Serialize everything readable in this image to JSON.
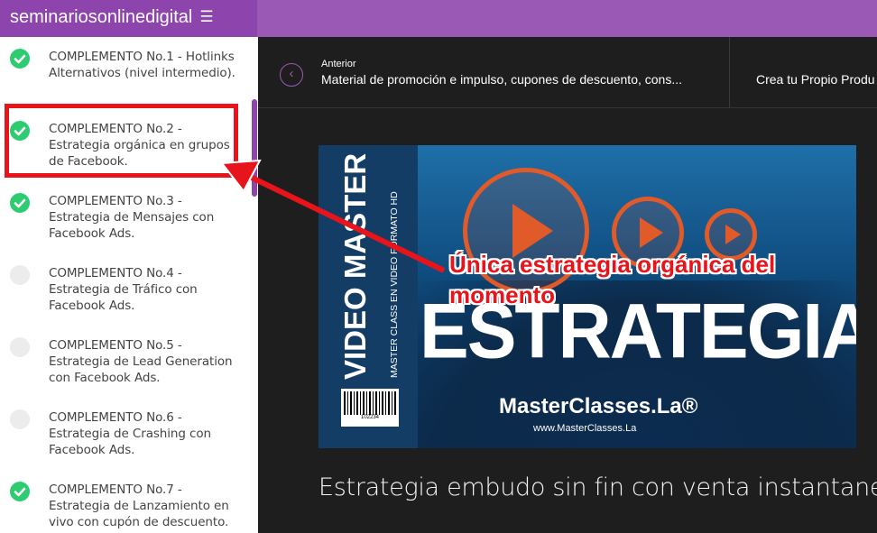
{
  "app": {
    "brand": "seminariosonlinedigital",
    "menu_icon": "hamburger-icon"
  },
  "sidebar": {
    "items": [
      {
        "label": "COMPLEMENTO No.1 - Hotlinks Alternativos (nivel intermedio).",
        "completed": true
      },
      {
        "label": "COMPLEMENTO No.2 - Estrategia orgánica en grupos de Facebook.",
        "completed": true
      },
      {
        "label": "COMPLEMENTO No.3 - Estrategia de Mensajes con Facebook Ads.",
        "completed": true
      },
      {
        "label": "COMPLEMENTO No.4 - Estrategia de Tráfico con Facebook Ads.",
        "completed": false
      },
      {
        "label": "COMPLEMENTO No.5 - Estrategia de Lead Generation con Facebook Ads.",
        "completed": false
      },
      {
        "label": "COMPLEMENTO No.6 - Estrategia de Crashing con Facebook Ads.",
        "completed": false
      },
      {
        "label": "COMPLEMENTO No.7 - Estrategia de Lanzamiento en vivo con cupón de descuento.",
        "completed": true
      }
    ]
  },
  "nav": {
    "prev_label": "Anterior",
    "prev_title": "Material de promoción e impulso, cupones de descuento, cons...",
    "next_title": "Crea tu Propio Produ"
  },
  "thumbnail": {
    "vertical_title": "VIDEO MASTER CLASS",
    "vertical_subtitle": "MASTER CLASS EN VIDEO FORMATO HD",
    "barcode_number": "102234",
    "big_title": "ESTRATEGIAS",
    "logo": "MasterClasses.La®",
    "url": "www.MasterClasses.La"
  },
  "annotation": {
    "text": "Única estrategia orgánica del momento"
  },
  "lesson": {
    "title": "Estrategia embudo sin fin con venta instantanea"
  },
  "colors": {
    "purple": "#8e44ad",
    "green": "#2ecc71",
    "red": "#e8141b",
    "dark": "#1e1e1e"
  }
}
